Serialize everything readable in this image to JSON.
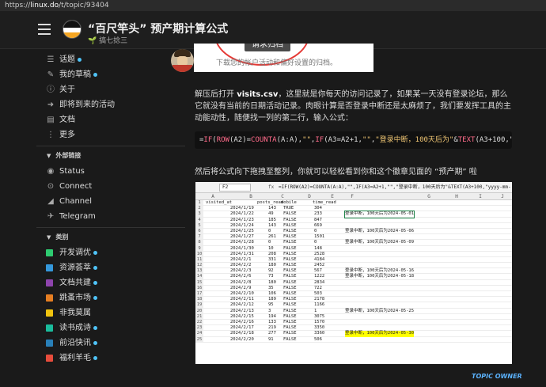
{
  "browser": {
    "url_prefix": "https://",
    "url_host": "linux.do",
    "url_path": "/t/topic/93404"
  },
  "header": {
    "title": "“百尺竿头” 预产期计算公式",
    "subtitle_icon": "🌱",
    "subtitle": "搞七捻三"
  },
  "sidebar": {
    "main": [
      {
        "icon": "☰",
        "label": "话题",
        "dot": true
      },
      {
        "icon": "✎",
        "label": "我的草稿",
        "dot": true
      },
      {
        "icon": "ⓘ",
        "label": "关于",
        "dot": false
      },
      {
        "icon": "➜",
        "label": "即将到来的活动",
        "dot": false
      },
      {
        "icon": "▤",
        "label": "文档",
        "dot": false
      },
      {
        "icon": "⋮",
        "label": "更多",
        "dot": false
      }
    ],
    "links_title": "外部链接",
    "links": [
      {
        "icon": "◉",
        "label": "Status"
      },
      {
        "icon": "⊙",
        "label": "Connect"
      },
      {
        "icon": "◢",
        "label": "Channel"
      },
      {
        "icon": "✈",
        "label": "Telegram"
      }
    ],
    "cats_title": "类别",
    "cats": [
      {
        "color": "#2ecc71",
        "label": "开发调优",
        "dot": true
      },
      {
        "color": "#3498db",
        "label": "资源荟萃",
        "dot": true
      },
      {
        "color": "#8e44ad",
        "label": "文档共建",
        "dot": true
      },
      {
        "color": "#e67e22",
        "label": "跳蚤市场",
        "dot": true
      },
      {
        "color": "#f1c40f",
        "label": "非我莫属",
        "dot": false
      },
      {
        "color": "#1abc9c",
        "label": "读书成诗",
        "dot": true
      },
      {
        "color": "#2980b9",
        "label": "前沿快讯",
        "dot": true
      },
      {
        "color": "#e74c3c",
        "label": "福利羊毛",
        "dot": true
      }
    ]
  },
  "post": {
    "shot1_btn": "请求归档",
    "shot1_text": "下载您的帐户活动和偏好设置的归档。",
    "p1_a": "解压后打开 ",
    "p1_b": "visits.csv",
    "p1_c": "，这里就是你每天的访问记录了，如果某一天没有登录论坛，那么它就没有当前的日期活动记录。肉眼计算是否登录中断还是太麻烦了，我们要发挥工具的主动能动性，随便找一列的第二行，输入公式：",
    "code": "=IF(ROW(A2)=COUNTA(A:A),\"\",IF(A3=A2+1,\"\",\"登录中断，100天后为\"&TEXT(A3+100,\"yyyy-mm-d",
    "p2": "然后将公式向下拖拽至整列，你就可以轻松看到你和这个徽章见面的 “预产期” 啦",
    "owner": "TOPIC OWNER"
  },
  "sheet": {
    "cellref": "F2",
    "fx": "fx",
    "formula": "=IF(ROW(A2)=COUNTA(A:A),\"\",IF(A3=A2+1,\"\",\"登录中断，100天后为\"&TEXT(A3+100,\"yyyy-mm-dd\")))",
    "cols": [
      "A",
      "B",
      "C",
      "D",
      "E",
      "F",
      "G",
      "H",
      "I",
      "J"
    ],
    "headers": [
      "visited_at",
      "posts_read",
      "mobile",
      "time_read"
    ],
    "rows": [
      [
        "2024/1/19",
        "143",
        "TRUE",
        "304",
        ""
      ],
      [
        "2024/1/22",
        "49",
        "FALSE",
        "233",
        "登录中断，100天后为2024-05-01"
      ],
      [
        "2024/1/23",
        "185",
        "FALSE",
        "847",
        ""
      ],
      [
        "2024/1/24",
        "143",
        "FALSE",
        "669",
        ""
      ],
      [
        "2024/1/25",
        "0",
        "FALSE",
        "0",
        "登录中断，100天后为2024-05-06"
      ],
      [
        "2024/1/27",
        "261",
        "FALSE",
        "1501",
        ""
      ],
      [
        "2024/1/28",
        "0",
        "FALSE",
        "0",
        "登录中断，100天后为2024-05-09"
      ],
      [
        "2024/1/30",
        "10",
        "FALSE",
        "148",
        ""
      ],
      [
        "2024/1/31",
        "208",
        "FALSE",
        "2528",
        ""
      ],
      [
        "2024/2/1",
        "331",
        "FALSE",
        "4184",
        ""
      ],
      [
        "2024/2/2",
        "180",
        "FALSE",
        "2452",
        ""
      ],
      [
        "2024/2/3",
        "92",
        "FALSE",
        "567",
        "登录中断，100天后为2024-05-16"
      ],
      [
        "2024/2/6",
        "73",
        "FALSE",
        "1222",
        "登录中断，100天后为2024-05-18"
      ],
      [
        "2024/2/8",
        "180",
        "FALSE",
        "2834",
        ""
      ],
      [
        "2024/2/9",
        "35",
        "FALSE",
        "722",
        ""
      ],
      [
        "2024/2/10",
        "106",
        "FALSE",
        "503",
        ""
      ],
      [
        "2024/2/11",
        "189",
        "FALSE",
        "2178",
        ""
      ],
      [
        "2024/2/12",
        "95",
        "FALSE",
        "1166",
        ""
      ],
      [
        "2024/2/13",
        "3",
        "FALSE",
        "1",
        "登录中断，100天后为2024-05-25"
      ],
      [
        "2024/2/15",
        "194",
        "FALSE",
        "3075",
        ""
      ],
      [
        "2024/2/16",
        "133",
        "FALSE",
        "1570",
        ""
      ],
      [
        "2024/2/17",
        "219",
        "FALSE",
        "3350",
        ""
      ],
      [
        "2024/2/18",
        "277",
        "FALSE",
        "3360",
        "登录中断，100天后为2024-05-30"
      ],
      [
        "2024/2/20",
        "91",
        "FALSE",
        "506",
        ""
      ]
    ]
  }
}
